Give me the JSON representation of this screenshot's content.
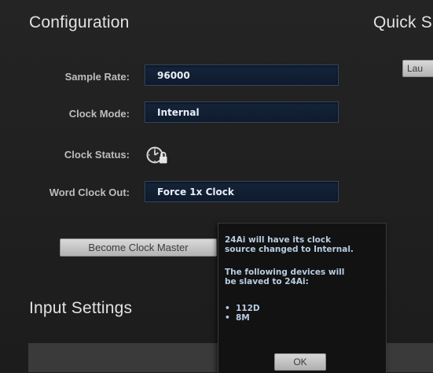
{
  "configuration": {
    "title": "Configuration",
    "sample_rate": {
      "label": "Sample Rate:",
      "value": "96000"
    },
    "clock_mode": {
      "label": "Clock Mode:",
      "value": "Internal"
    },
    "clock_status": {
      "label": "Clock Status:",
      "icon": "clock-lock-icon"
    },
    "word_clock_out": {
      "label": "Word Clock Out:",
      "value": "Force 1x Clock"
    },
    "become_master_label": "Become Clock Master"
  },
  "quick_setup": {
    "title": "Quick S",
    "launch_label": "Lau"
  },
  "input_settings": {
    "title": "Input Settings"
  },
  "popup": {
    "line1": "24Ai will have its clock",
    "line2": "source changed to Internal.",
    "line3": "The following devices will",
    "line4": "be slaved to 24Ai:",
    "devices": [
      "112D",
      "8M"
    ],
    "ok_label": "OK"
  }
}
